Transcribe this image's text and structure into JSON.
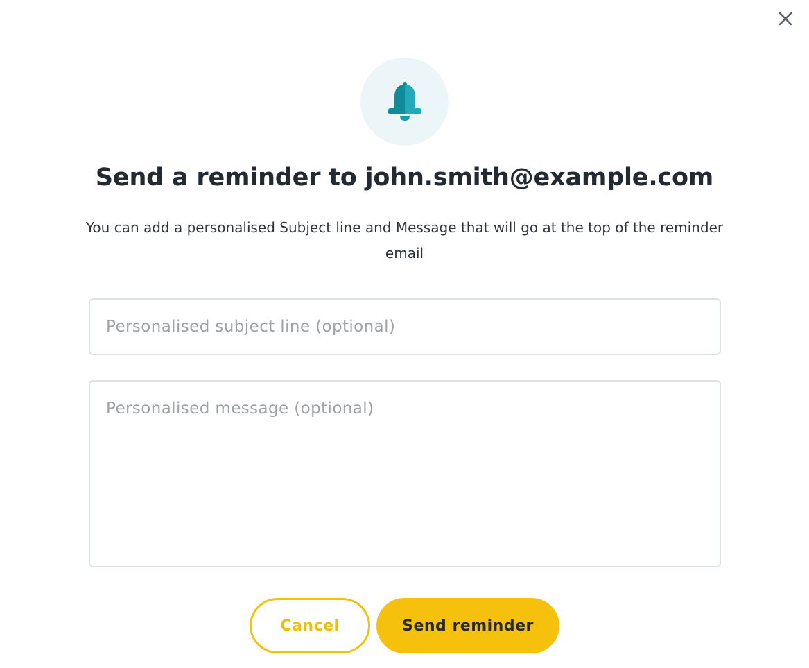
{
  "dialog": {
    "close_icon": "close-icon",
    "header_icon": "bell-icon",
    "title": "Send a reminder to john.smith@example.com",
    "description": "You can add a personalised Subject line and Message that will go at the top of the reminder email"
  },
  "form": {
    "subject": {
      "placeholder": "Personalised subject line (optional)",
      "value": ""
    },
    "message": {
      "placeholder": "Personalised message (optional)",
      "value": ""
    }
  },
  "actions": {
    "cancel_label": "Cancel",
    "send_label": "Send reminder"
  },
  "colors": {
    "accent": "#f5c10c",
    "bell": "#1a9aaa",
    "icon_bg": "#ecf5f8",
    "title_text": "#232a31"
  }
}
